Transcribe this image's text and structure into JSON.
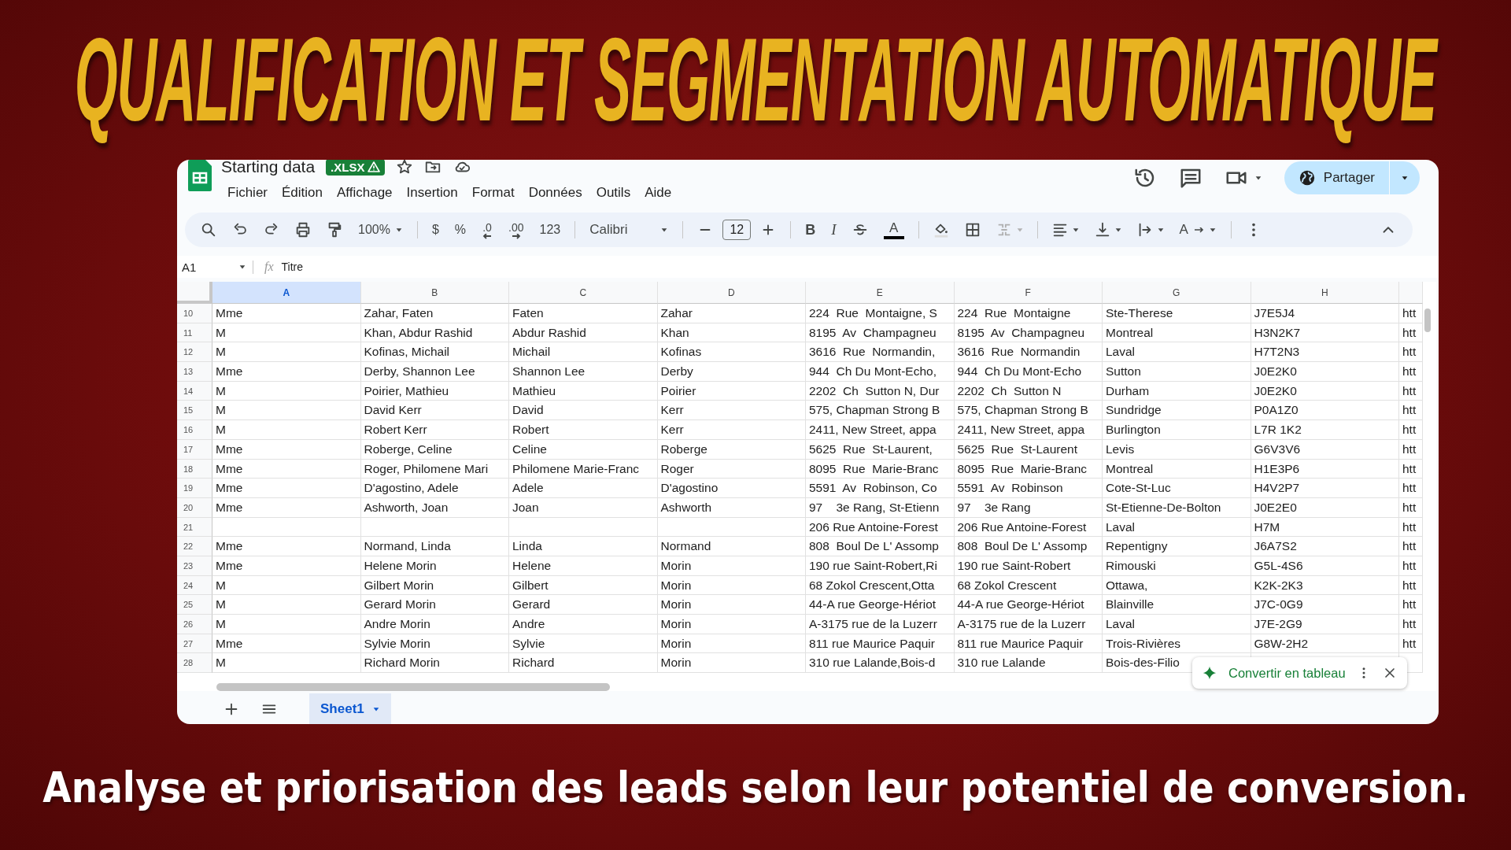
{
  "title": "QUALIFICATION ET SEGMENTATION AUTOMATIQUE",
  "subtitle": "Analyse et priorisation des leads selon leur potentiel de conversion.",
  "sheet": {
    "doc_title": "Starting data",
    "format_badge": ".XLSX",
    "menu": [
      "Fichier",
      "Édition",
      "Affichage",
      "Insertion",
      "Format",
      "Données",
      "Outils",
      "Aide"
    ],
    "share_button": "Partager",
    "toolbar": {
      "zoom": "100%",
      "currency": "$",
      "percent": "%",
      "decrease_decimal": ".0",
      "increase_decimal": ".00",
      "number_format": "123",
      "font": "Calibri",
      "font_size": "12",
      "bold": "B",
      "italic": "I",
      "text_color": "A",
      "text_rotation": "A"
    },
    "name_box": "A1",
    "formula_label": "fx",
    "formula": "Titre",
    "columns": [
      {
        "label": "A",
        "selected": true
      },
      {
        "label": "B",
        "selected": false
      },
      {
        "label": "C",
        "selected": false
      },
      {
        "label": "D",
        "selected": false
      },
      {
        "label": "E",
        "selected": false
      },
      {
        "label": "F",
        "selected": false
      },
      {
        "label": "G",
        "selected": false
      },
      {
        "label": "H",
        "selected": false
      }
    ],
    "rows": [
      {
        "number": "10",
        "cells": [
          "Mme",
          "Zahar, Faten",
          "Faten",
          "Zahar",
          "224  Rue  Montaigne, S",
          "224  Rue  Montaigne",
          "Ste-Therese",
          "J7E5J4",
          "htt"
        ]
      },
      {
        "number": "11",
        "cells": [
          "M",
          "Khan, Abdur Rashid",
          "Abdur Rashid",
          "Khan",
          "8195  Av  Champagneu",
          "8195  Av  Champagneu",
          "Montreal",
          "H3N2K7",
          "htt"
        ]
      },
      {
        "number": "12",
        "cells": [
          "M",
          "Kofinas, Michail",
          "Michail",
          "Kofinas",
          "3616  Rue  Normandin,",
          "3616  Rue  Normandin",
          "Laval",
          "H7T2N3",
          "htt"
        ]
      },
      {
        "number": "13",
        "cells": [
          "Mme",
          "Derby, Shannon Lee",
          "Shannon Lee",
          "Derby",
          "944  Ch Du Mont-Echo,",
          "944  Ch Du Mont-Echo",
          "Sutton",
          "J0E2K0",
          "htt"
        ]
      },
      {
        "number": "14",
        "cells": [
          "M",
          "Poirier, Mathieu",
          "Mathieu",
          "Poirier",
          "2202  Ch  Sutton N, Dur",
          "2202  Ch  Sutton N",
          "Durham",
          "J0E2K0",
          "htt"
        ]
      },
      {
        "number": "15",
        "cells": [
          "M",
          "David Kerr",
          "David",
          "Kerr",
          "575, Chapman Strong B",
          "575, Chapman Strong B",
          "Sundridge",
          "P0A1Z0",
          "htt"
        ]
      },
      {
        "number": "16",
        "cells": [
          "M",
          "Robert Kerr",
          "Robert",
          "Kerr",
          "2411, New Street, appa",
          "2411, New Street, appa",
          "Burlington",
          "L7R 1K2",
          "htt"
        ]
      },
      {
        "number": "17",
        "cells": [
          "Mme",
          "Roberge, Celine",
          "Celine",
          "Roberge",
          "5625  Rue  St-Laurent,",
          "5625  Rue  St-Laurent",
          "Levis",
          "G6V3V6",
          "htt"
        ]
      },
      {
        "number": "18",
        "cells": [
          "Mme",
          "Roger, Philomene Mari",
          "Philomene Marie-Franc",
          "Roger",
          "8095  Rue  Marie-Branc",
          "8095  Rue  Marie-Branc",
          "Montreal",
          "H1E3P6",
          "htt"
        ]
      },
      {
        "number": "19",
        "cells": [
          "Mme",
          "D'agostino, Adele",
          "Adele",
          "D'agostino",
          "5591  Av  Robinson, Co",
          "5591  Av  Robinson",
          "Cote-St-Luc",
          "H4V2P7",
          "htt"
        ]
      },
      {
        "number": "20",
        "cells": [
          "Mme",
          "Ashworth, Joan",
          "Joan",
          "Ashworth",
          "97    3e Rang, St-Etienn",
          "97    3e Rang",
          "St-Etienne-De-Bolton",
          "J0E2E0",
          "htt"
        ]
      },
      {
        "number": "21",
        "cells": [
          null,
          null,
          null,
          null,
          "206 Rue Antoine-Forest",
          "206 Rue Antoine-Forest",
          "Laval",
          "H7M",
          "htt"
        ]
      },
      {
        "number": "22",
        "cells": [
          "Mme",
          "Normand, Linda",
          "Linda",
          "Normand",
          "808  Boul De L' Assomp",
          "808  Boul De L' Assomp",
          "Repentigny",
          "J6A7S2",
          "htt"
        ]
      },
      {
        "number": "23",
        "cells": [
          "Mme",
          "Helene Morin",
          "Helene",
          "Morin",
          "190 rue Saint-Robert,Ri",
          "190 rue Saint-Robert",
          "Rimouski",
          "G5L-4S6",
          "htt"
        ]
      },
      {
        "number": "24",
        "cells": [
          "M",
          "Gilbert Morin",
          "Gilbert",
          "Morin",
          "68 Zokol Crescent,Otta",
          "68 Zokol Crescent",
          "Ottawa,",
          "K2K-2K3",
          "htt"
        ]
      },
      {
        "number": "25",
        "cells": [
          "M",
          "Gerard Morin",
          "Gerard",
          "Morin",
          "44-A rue George-Hériot",
          "44-A rue George-Hériot",
          "Blainville",
          "J7C-0G9",
          "htt"
        ]
      },
      {
        "number": "26",
        "cells": [
          "M",
          "Andre Morin",
          "Andre",
          "Morin",
          "A-3175 rue de la Luzerr",
          "A-3175 rue de la Luzerr",
          "Laval",
          "J7E-2G9",
          "htt"
        ]
      },
      {
        "number": "27",
        "cells": [
          "Mme",
          "Sylvie Morin",
          "Sylvie",
          "Morin",
          "811 rue Maurice Paquir",
          "811 rue Maurice Paquir",
          "Trois-Rivières",
          "G8W-2H2",
          "htt"
        ]
      },
      {
        "number": "28",
        "cells": [
          "M",
          "Richard Morin",
          "Richard",
          "Morin",
          "310 rue Lalande,Bois-d",
          "310 rue Lalande",
          "Bois-des-Filio"
        ]
      }
    ],
    "sheet_tabs": [
      {
        "label": "Sheet1",
        "selected": true
      }
    ],
    "toast": "Convertir en tableau"
  }
}
